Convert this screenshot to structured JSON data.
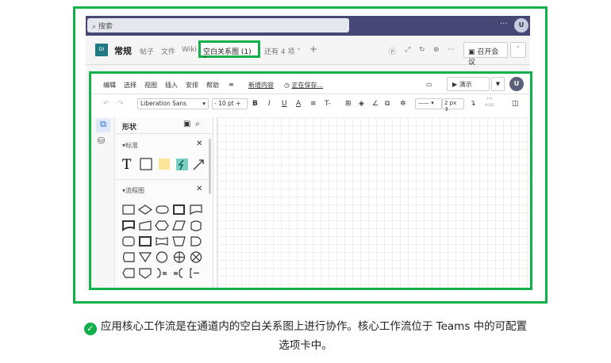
{
  "teams": {
    "search_placeholder": "搜索",
    "avatar": "U",
    "channel_badge": "DI",
    "channel": "常规",
    "tabs": [
      "帖子",
      "文件",
      "Wiki",
      "空白关系图 (1)",
      "还有 4 项"
    ],
    "meet_button": "召开会议"
  },
  "drawio": {
    "menu": [
      "编辑",
      "选择",
      "视图",
      "插入",
      "安排",
      "帮助"
    ],
    "add_content": "新增内容",
    "saving": "正在保存...",
    "present": "演示",
    "avatar": "U",
    "font": "Liberation Sans",
    "font_size": "10 pt",
    "line_width": "2 px",
    "more": "MORE",
    "panel_title": "形状",
    "section_standard": "标准",
    "section_flowchart": "流程图"
  },
  "caption": {
    "line1": "应用核心工作流是在通道内的空白关系图上进行协作。核心工作流位于 Teams 中的可配置",
    "line2": "选项卡中。"
  },
  "colors": {
    "highlight": "#12b04a",
    "teams_bar": "#464775"
  }
}
